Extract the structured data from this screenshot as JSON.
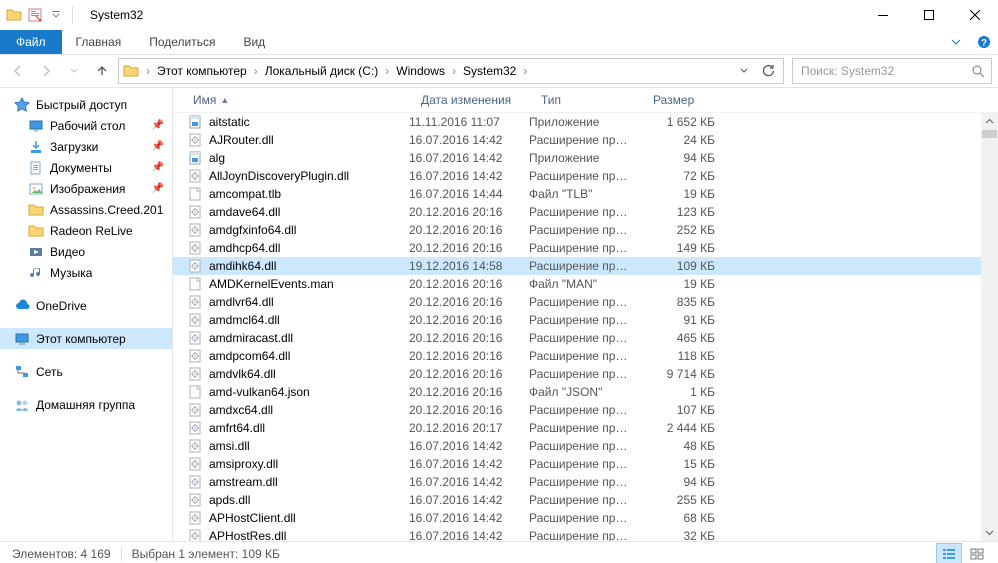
{
  "window": {
    "title": "System32"
  },
  "ribbon": {
    "file": "Файл",
    "tabs": [
      "Главная",
      "Поделиться",
      "Вид"
    ]
  },
  "breadcrumbs": [
    "Этот компьютер",
    "Локальный диск (C:)",
    "Windows",
    "System32"
  ],
  "search": {
    "placeholder": "Поиск: System32"
  },
  "tree": {
    "quick": "Быстрый доступ",
    "quick_items": [
      {
        "label": "Рабочий стол",
        "pin": true,
        "icon": "desktop"
      },
      {
        "label": "Загрузки",
        "pin": true,
        "icon": "downloads"
      },
      {
        "label": "Документы",
        "pin": true,
        "icon": "documents"
      },
      {
        "label": "Изображения",
        "pin": true,
        "icon": "pictures"
      },
      {
        "label": "Assassins.Creed.201",
        "pin": false,
        "icon": "folder"
      },
      {
        "label": "Radeon ReLive",
        "pin": false,
        "icon": "folder"
      },
      {
        "label": "Видео",
        "pin": false,
        "icon": "videos"
      },
      {
        "label": "Музыка",
        "pin": false,
        "icon": "music"
      }
    ],
    "onedrive": "OneDrive",
    "thispc": "Этот компьютер",
    "network": "Сеть",
    "homegroup": "Домашняя группа"
  },
  "columns": {
    "name": "Имя",
    "date": "Дата изменения",
    "type": "Тип",
    "size": "Размер"
  },
  "files": [
    {
      "name": "aitstatic",
      "date": "11.11.2016 11:07",
      "type": "Приложение",
      "size": "1 652 КБ",
      "icon": "exe"
    },
    {
      "name": "AJRouter.dll",
      "date": "16.07.2016 14:42",
      "type": "Расширение при...",
      "size": "24 КБ",
      "icon": "dll"
    },
    {
      "name": "alg",
      "date": "16.07.2016 14:42",
      "type": "Приложение",
      "size": "94 КБ",
      "icon": "exe"
    },
    {
      "name": "AllJoynDiscoveryPlugin.dll",
      "date": "16.07.2016 14:42",
      "type": "Расширение при...",
      "size": "72 КБ",
      "icon": "dll"
    },
    {
      "name": "amcompat.tlb",
      "date": "16.07.2016 14:44",
      "type": "Файл \"TLB\"",
      "size": "19 КБ",
      "icon": "file"
    },
    {
      "name": "amdave64.dll",
      "date": "20.12.2016 20:16",
      "type": "Расширение при...",
      "size": "123 КБ",
      "icon": "dll"
    },
    {
      "name": "amdgfxinfo64.dll",
      "date": "20.12.2016 20:16",
      "type": "Расширение при...",
      "size": "252 КБ",
      "icon": "dll"
    },
    {
      "name": "amdhcp64.dll",
      "date": "20.12.2016 20:16",
      "type": "Расширение при...",
      "size": "149 КБ",
      "icon": "dll"
    },
    {
      "name": "amdihk64.dll",
      "date": "19.12.2016 14:58",
      "type": "Расширение при...",
      "size": "109 КБ",
      "icon": "dll",
      "selected": true
    },
    {
      "name": "AMDKernelEvents.man",
      "date": "20.12.2016 20:16",
      "type": "Файл \"MAN\"",
      "size": "19 КБ",
      "icon": "file"
    },
    {
      "name": "amdlvr64.dll",
      "date": "20.12.2016 20:16",
      "type": "Расширение при...",
      "size": "835 КБ",
      "icon": "dll"
    },
    {
      "name": "amdmcl64.dll",
      "date": "20.12.2016 20:16",
      "type": "Расширение при...",
      "size": "91 КБ",
      "icon": "dll"
    },
    {
      "name": "amdmiracast.dll",
      "date": "20.12.2016 20:16",
      "type": "Расширение при...",
      "size": "465 КБ",
      "icon": "dll"
    },
    {
      "name": "amdpcom64.dll",
      "date": "20.12.2016 20:16",
      "type": "Расширение при...",
      "size": "118 КБ",
      "icon": "dll"
    },
    {
      "name": "amdvlk64.dll",
      "date": "20.12.2016 20:16",
      "type": "Расширение при...",
      "size": "9 714 КБ",
      "icon": "dll"
    },
    {
      "name": "amd-vulkan64.json",
      "date": "20.12.2016 20:16",
      "type": "Файл \"JSON\"",
      "size": "1 КБ",
      "icon": "file"
    },
    {
      "name": "amdxc64.dll",
      "date": "20.12.2016 20:16",
      "type": "Расширение при...",
      "size": "107 КБ",
      "icon": "dll"
    },
    {
      "name": "amfrt64.dll",
      "date": "20.12.2016 20:17",
      "type": "Расширение при...",
      "size": "2 444 КБ",
      "icon": "dll"
    },
    {
      "name": "amsi.dll",
      "date": "16.07.2016 14:42",
      "type": "Расширение при...",
      "size": "48 КБ",
      "icon": "dll"
    },
    {
      "name": "amsiproxy.dll",
      "date": "16.07.2016 14:42",
      "type": "Расширение при...",
      "size": "15 КБ",
      "icon": "dll"
    },
    {
      "name": "amstream.dll",
      "date": "16.07.2016 14:42",
      "type": "Расширение при...",
      "size": "94 КБ",
      "icon": "dll"
    },
    {
      "name": "apds.dll",
      "date": "16.07.2016 14:42",
      "type": "Расширение при...",
      "size": "255 КБ",
      "icon": "dll"
    },
    {
      "name": "APHostClient.dll",
      "date": "16.07.2016 14:42",
      "type": "Расширение при...",
      "size": "68 КБ",
      "icon": "dll"
    },
    {
      "name": "APHostRes.dll",
      "date": "16.07.2016 14:42",
      "type": "Расширение при...",
      "size": "32 КБ",
      "icon": "dll"
    }
  ],
  "status": {
    "count_label": "Элементов:",
    "count": "4 169",
    "sel_label": "Выбран 1 элемент: 109 КБ"
  }
}
